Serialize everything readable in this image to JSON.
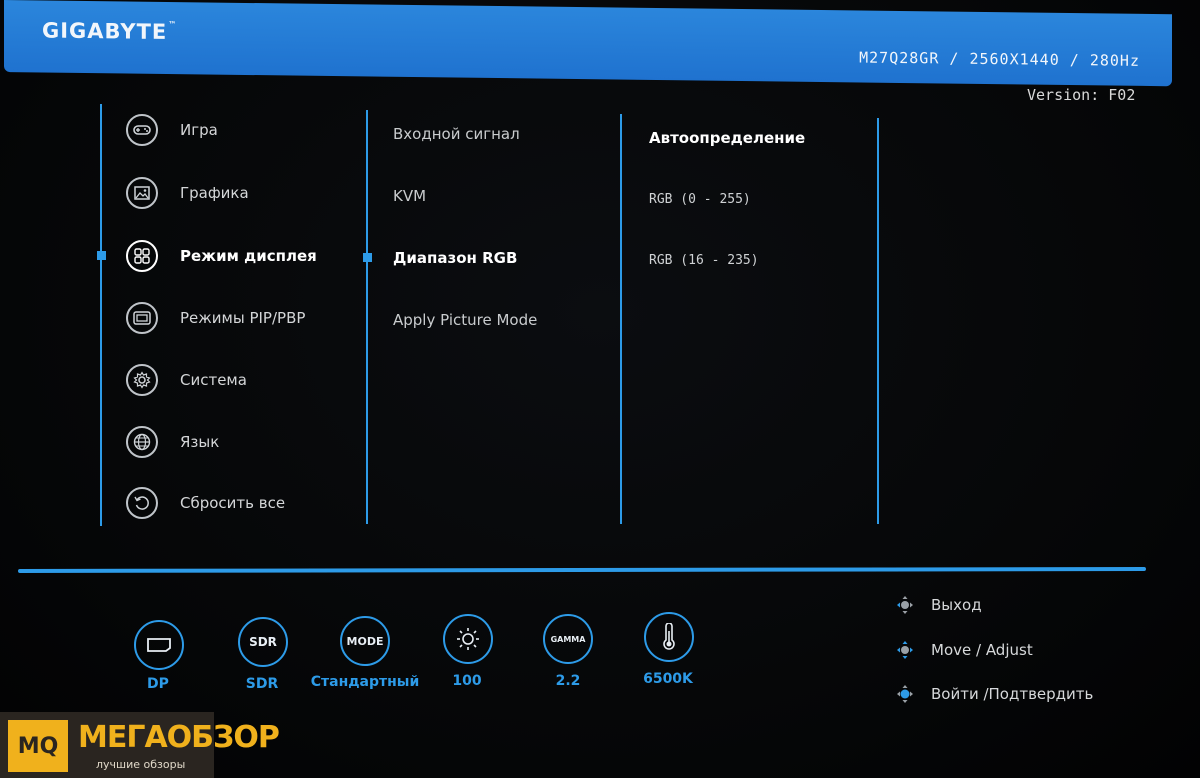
{
  "header": {
    "brand": "GIGABYTE",
    "model_info": "M27Q28GR / 2560X1440 / 280Hz",
    "version": "Version: F02"
  },
  "menu": [
    {
      "label": "Игра",
      "icon": "gamepad-icon",
      "active": false
    },
    {
      "label": "Графика",
      "icon": "picture-icon",
      "active": false
    },
    {
      "label": "Режим дисплея",
      "icon": "grid-icon",
      "active": true
    },
    {
      "label": "Режимы PIP/PBP",
      "icon": "pip-icon",
      "active": false
    },
    {
      "label": "Система",
      "icon": "gear-icon",
      "active": false
    },
    {
      "label": "Язык",
      "icon": "globe-icon",
      "active": false
    },
    {
      "label": "Сбросить все",
      "icon": "reset-icon",
      "active": false
    }
  ],
  "submenu": [
    {
      "label": "Входной сигнал",
      "active": false
    },
    {
      "label": "KVM",
      "active": false
    },
    {
      "label": "Диапазон RGB",
      "active": true
    },
    {
      "label": "Apply Picture Mode",
      "active": false
    }
  ],
  "options": [
    {
      "label": "Автоопределение",
      "selected": true
    },
    {
      "label": "RGB (0 - 255)",
      "selected": false
    },
    {
      "label": "RGB (16 - 235)",
      "selected": false
    }
  ],
  "status_bar": [
    {
      "icon": "displayport-icon",
      "icon_text": "",
      "label": "DP"
    },
    {
      "icon": "sdr-icon",
      "icon_text": "SDR",
      "label": "SDR"
    },
    {
      "icon": "mode-icon",
      "icon_text": "MODE",
      "label": "Стандартный"
    },
    {
      "icon": "brightness-icon",
      "icon_text": "",
      "label": "100"
    },
    {
      "icon": "gamma-icon",
      "icon_text": "GAMMA",
      "label": "2.2"
    },
    {
      "icon": "thermometer-icon",
      "icon_text": "",
      "label": "6500K"
    }
  ],
  "hints": [
    {
      "icon": "joystick-left-icon",
      "label": "Выход"
    },
    {
      "icon": "joystick-move-icon",
      "label": "Move / Adjust"
    },
    {
      "icon": "joystick-press-icon",
      "label": "Войти /Подтвердить"
    }
  ],
  "watermark": {
    "logo": "MQ",
    "name": "МЕГАОБЗОР",
    "tagline": "лучшие обзоры"
  },
  "colors": {
    "accent": "#2d9be8",
    "header": "#1f72cf"
  }
}
